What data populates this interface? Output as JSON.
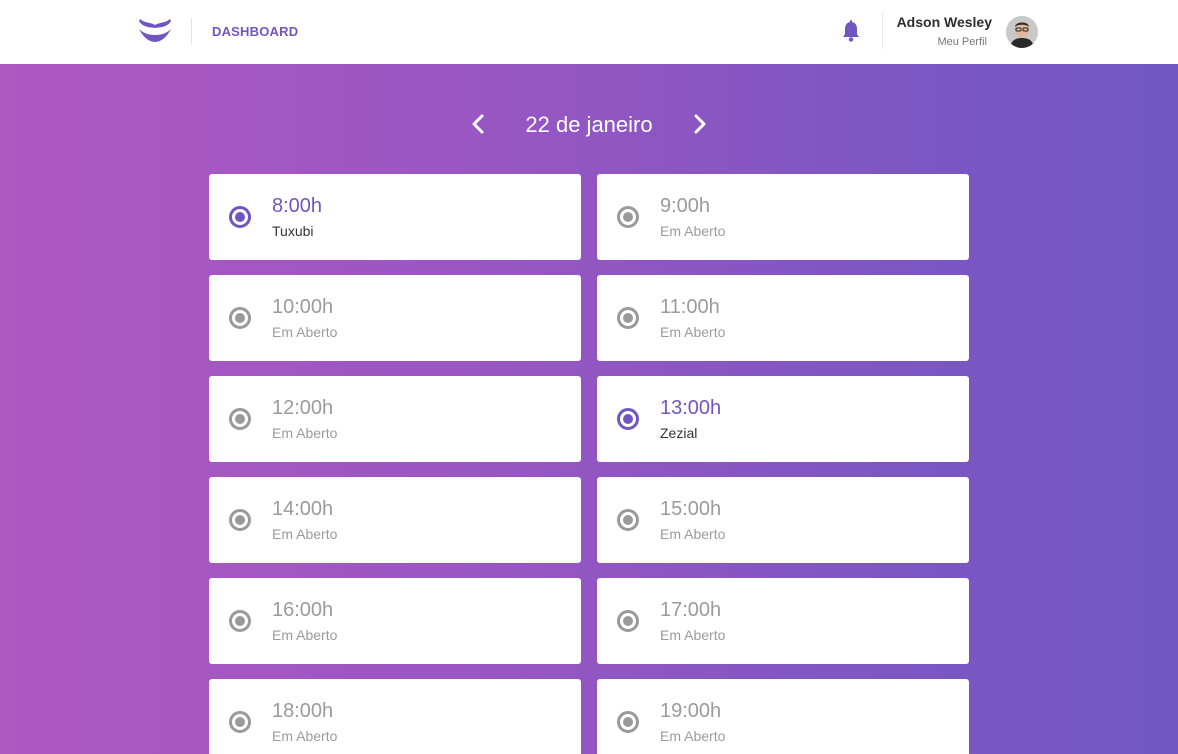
{
  "header": {
    "nav_label": "DASHBOARD",
    "user_name": "Adson Wesley",
    "profile_link": "Meu Perfil",
    "icons": [
      "mustache-logo-icon",
      "bell-icon",
      "avatar"
    ],
    "accent_color": "#7155c0"
  },
  "date_nav": {
    "title": "22 de janeiro",
    "icons": [
      "chevron-left-icon",
      "chevron-right-icon"
    ]
  },
  "slots": [
    {
      "time": "8:00h",
      "label": "Tuxubi",
      "booked": true
    },
    {
      "time": "9:00h",
      "label": "Em Aberto",
      "booked": false
    },
    {
      "time": "10:00h",
      "label": "Em Aberto",
      "booked": false
    },
    {
      "time": "11:00h",
      "label": "Em Aberto",
      "booked": false
    },
    {
      "time": "12:00h",
      "label": "Em Aberto",
      "booked": false
    },
    {
      "time": "13:00h",
      "label": "Zezial",
      "booked": true
    },
    {
      "time": "14:00h",
      "label": "Em Aberto",
      "booked": false
    },
    {
      "time": "15:00h",
      "label": "Em Aberto",
      "booked": false
    },
    {
      "time": "16:00h",
      "label": "Em Aberto",
      "booked": false
    },
    {
      "time": "17:00h",
      "label": "Em Aberto",
      "booked": false
    },
    {
      "time": "18:00h",
      "label": "Em Aberto",
      "booked": false
    },
    {
      "time": "19:00h",
      "label": "Em Aberto",
      "booked": false
    }
  ]
}
